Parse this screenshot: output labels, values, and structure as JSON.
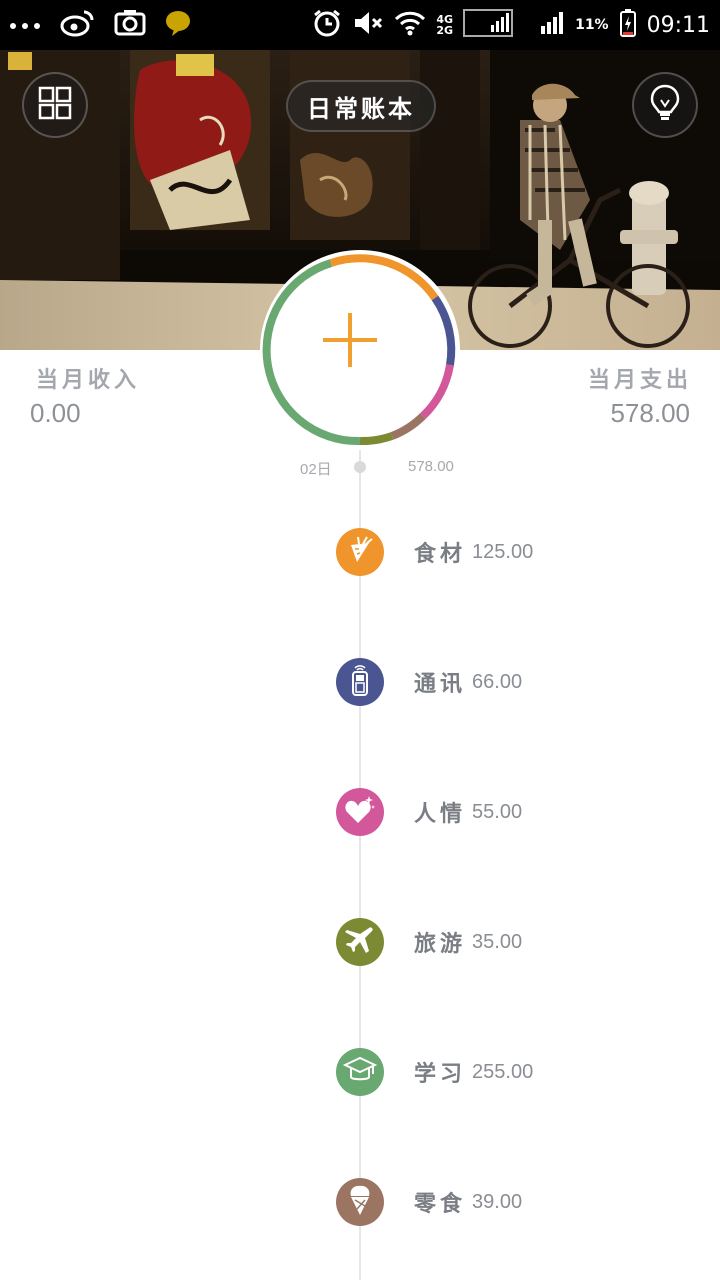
{
  "status_bar": {
    "time": "09:11",
    "battery": "11%",
    "network_top": "4G",
    "network_bottom": "2G"
  },
  "header": {
    "title": "日常账本",
    "menu_icon": "grid-icon",
    "tip_icon": "lightbulb-icon"
  },
  "summary": {
    "income_label": "当月收入",
    "income_value": "0.00",
    "expense_label": "当月支出",
    "expense_value": "578.00"
  },
  "day": {
    "date": "02日",
    "total": "578.00"
  },
  "entries": [
    {
      "name": "食材",
      "amount": "125.00",
      "icon": "carrot-icon",
      "color": "#f0952b"
    },
    {
      "name": "通讯",
      "amount": "66.00",
      "icon": "cellphone-icon",
      "color": "#4a5591"
    },
    {
      "name": "人情",
      "amount": "55.00",
      "icon": "heart-sparkle-icon",
      "color": "#d3579b"
    },
    {
      "name": "旅游",
      "amount": "35.00",
      "icon": "airplane-icon",
      "color": "#7d8a34"
    },
    {
      "name": "学习",
      "amount": "255.00",
      "icon": "graduation-cap-icon",
      "color": "#6aa872"
    },
    {
      "name": "零食",
      "amount": "39.00",
      "icon": "ice-cream-icon",
      "color": "#9b7462"
    }
  ],
  "colors": {
    "accent": "#f0a030",
    "ring_food": "#f0952b",
    "ring_comm": "#4a5591",
    "ring_gift": "#d3579b",
    "ring_snack": "#9b7462",
    "ring_travel": "#7d8a34",
    "ring_study": "#6aa872"
  }
}
